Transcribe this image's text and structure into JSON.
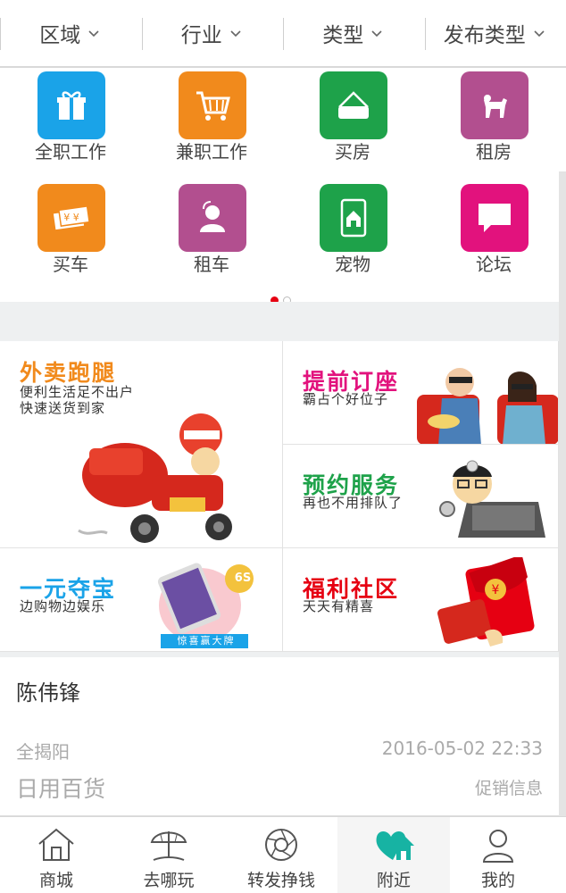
{
  "filters": [
    {
      "label": "区域"
    },
    {
      "label": "行业"
    },
    {
      "label": "类型"
    },
    {
      "label": "发布类型"
    }
  ],
  "categories": [
    {
      "label": "全职工作",
      "icon": "gift-icon",
      "color": "#1aa3e8"
    },
    {
      "label": "兼职工作",
      "icon": "cart-icon",
      "color": "#f18a1c"
    },
    {
      "label": "买房",
      "icon": "bag-icon",
      "color": "#1ea24a"
    },
    {
      "label": "租房",
      "icon": "dog-icon",
      "color": "#b24f8f"
    },
    {
      "label": "买车",
      "icon": "ticket-icon",
      "color": "#f18a1c"
    },
    {
      "label": "租车",
      "icon": "person-icon",
      "color": "#b24f8f"
    },
    {
      "label": "宠物",
      "icon": "tablet-home-icon",
      "color": "#1ea24a"
    },
    {
      "label": "论坛",
      "icon": "chat-bubble-icon",
      "color": "#e2127d"
    }
  ],
  "pager": {
    "active_index": 0,
    "count": 2
  },
  "promos": {
    "delivery": {
      "title": "外卖跑腿",
      "line1": "便利生活足不出户",
      "line2": "快速送货到家",
      "color": "#f18a1c"
    },
    "booking": {
      "title": "提前订座",
      "sub": "霸占个好位子",
      "color": "#e2127d"
    },
    "appointment": {
      "title": "预约服务",
      "sub": "再也不用排队了",
      "color": "#1ea24a"
    },
    "treasure": {
      "title": "一元夺宝",
      "sub": "边购物边娱乐",
      "color": "#1aa3e8",
      "badge": "惊喜赢大牌",
      "phone_label": "6S"
    },
    "welfare": {
      "title": "福利社区",
      "sub": "天天有精喜",
      "color": "#e60012"
    }
  },
  "listing": {
    "name": "陈伟锋",
    "area": "全揭阳",
    "time": "2016-05-02 22:33",
    "category": "日用百货",
    "type": "促销信息"
  },
  "tabs": [
    {
      "label": "商城",
      "icon": "home-icon"
    },
    {
      "label": "去哪玩",
      "icon": "umbrella-icon"
    },
    {
      "label": "转发挣钱",
      "icon": "aperture-icon"
    },
    {
      "label": "附近",
      "icon": "nearby-heart-home-icon",
      "active_color": "#17b3a3"
    },
    {
      "label": "我的",
      "icon": "user-icon"
    }
  ]
}
